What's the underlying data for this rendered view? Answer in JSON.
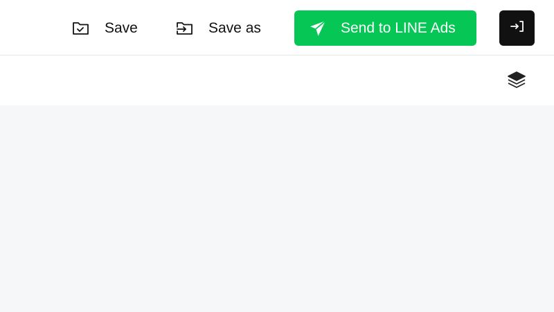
{
  "header": {
    "save_label": "Save",
    "save_icon": "folder-check-icon",
    "save_as_label": "Save as",
    "save_as_icon": "folder-import-icon",
    "send_label": "Send to LINE Ads",
    "send_icon": "paper-plane-icon",
    "exit_icon": "exit-arrow-icon"
  },
  "toolbar": {
    "layers_icon": "layers-icon"
  },
  "colors": {
    "accent_green": "#06c755",
    "dark_button": "#111111",
    "canvas_bg": "#f5f7f9"
  }
}
